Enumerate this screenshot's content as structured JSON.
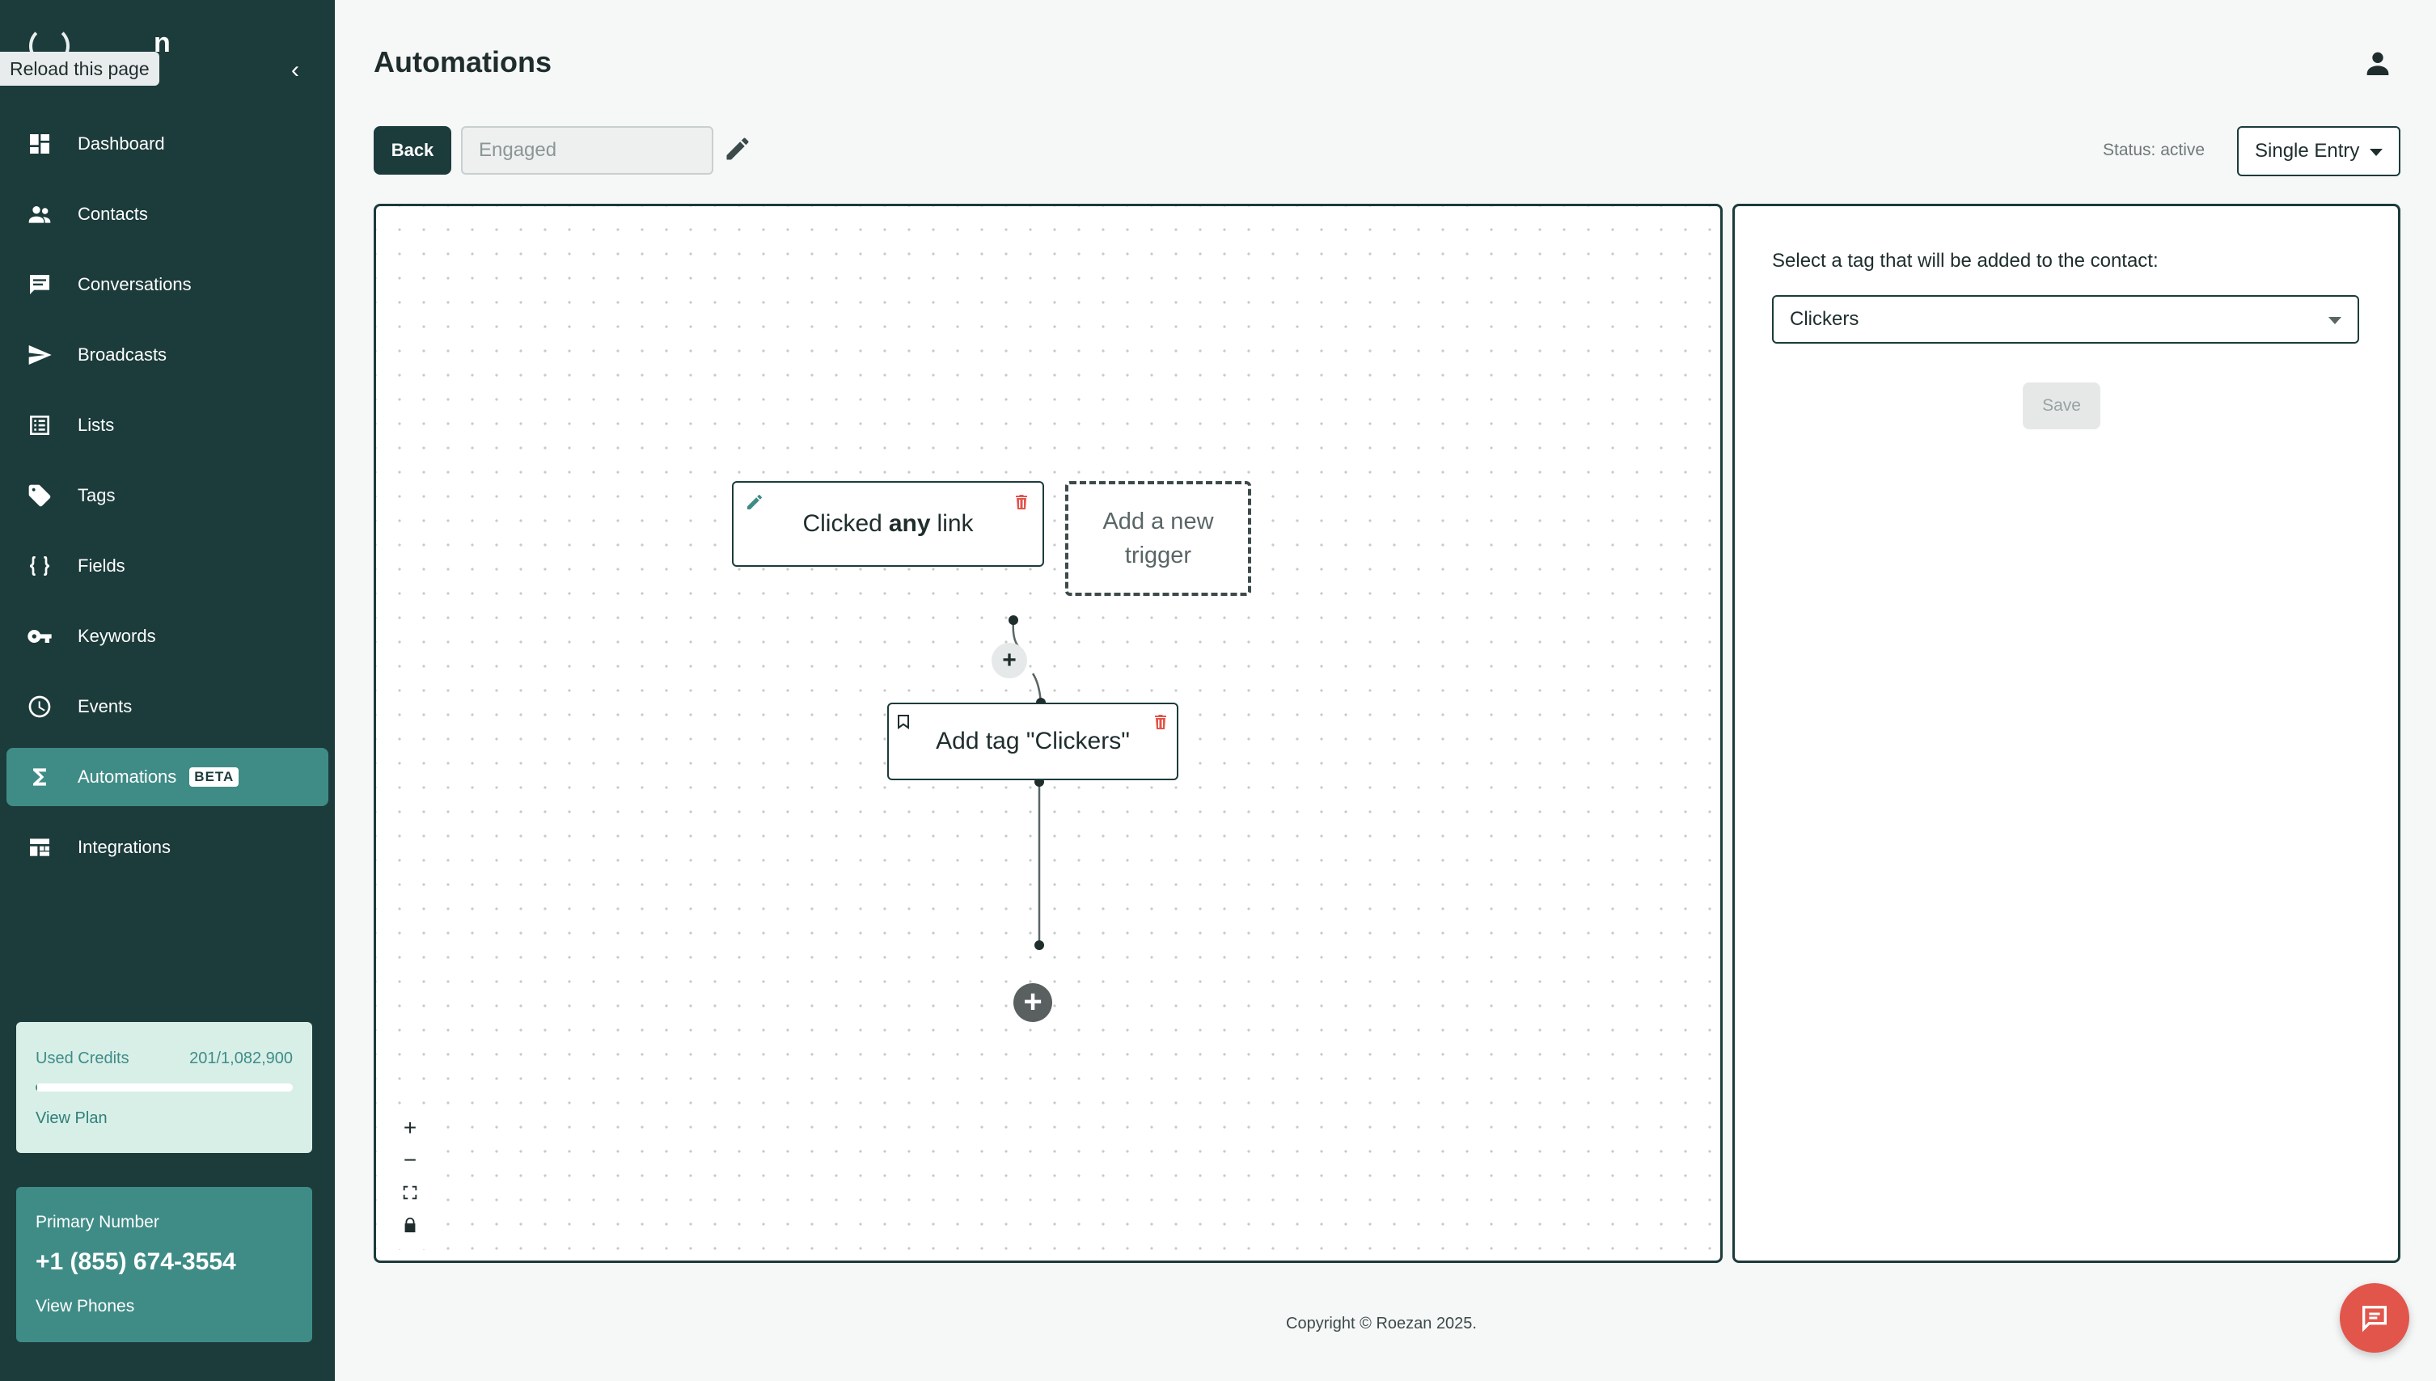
{
  "app": {
    "brand_letter": "n",
    "tooltip": "Reload this page"
  },
  "sidebar": {
    "items": [
      {
        "label": "Dashboard",
        "icon": "dashboard-icon"
      },
      {
        "label": "Contacts",
        "icon": "contacts-icon"
      },
      {
        "label": "Conversations",
        "icon": "conversations-icon"
      },
      {
        "label": "Broadcasts",
        "icon": "send-icon"
      },
      {
        "label": "Lists",
        "icon": "list-icon"
      },
      {
        "label": "Tags",
        "icon": "tag-icon"
      },
      {
        "label": "Fields",
        "icon": "braces-icon"
      },
      {
        "label": "Keywords",
        "icon": "key-icon"
      },
      {
        "label": "Events",
        "icon": "clock-icon"
      },
      {
        "label": "Automations",
        "icon": "sigma-icon",
        "badge": "BETA",
        "active": true
      },
      {
        "label": "Integrations",
        "icon": "integrations-icon"
      }
    ],
    "credits": {
      "label": "Used Credits",
      "value": "201/1,082,900",
      "link": "View Plan"
    },
    "phone": {
      "label": "Primary Number",
      "number": "+1 (855) 674-3554",
      "link": "View Phones"
    }
  },
  "header": {
    "title": "Automations"
  },
  "toolbar": {
    "back_label": "Back",
    "name_placeholder": "Engaged",
    "status": "Status: active",
    "entry_mode": "Single Entry"
  },
  "canvas": {
    "trigger": {
      "prefix": "Clicked",
      "emphasis": "any",
      "suffix": "link"
    },
    "add_trigger": "Add a new trigger",
    "action": "Add tag \"Clickers\"",
    "small_plus": "+",
    "big_plus": "+",
    "zoom": {
      "in": "+",
      "out": "−"
    }
  },
  "panel": {
    "label": "Select a tag that will be added to the contact:",
    "selected_tag": "Clickers",
    "save_label": "Save"
  },
  "footer": {
    "copyright": "Copyright © Roezan 2025."
  },
  "colors": {
    "sidebar_bg": "#1c3b3b",
    "accent": "#3f8c87",
    "danger": "#e2554b"
  }
}
